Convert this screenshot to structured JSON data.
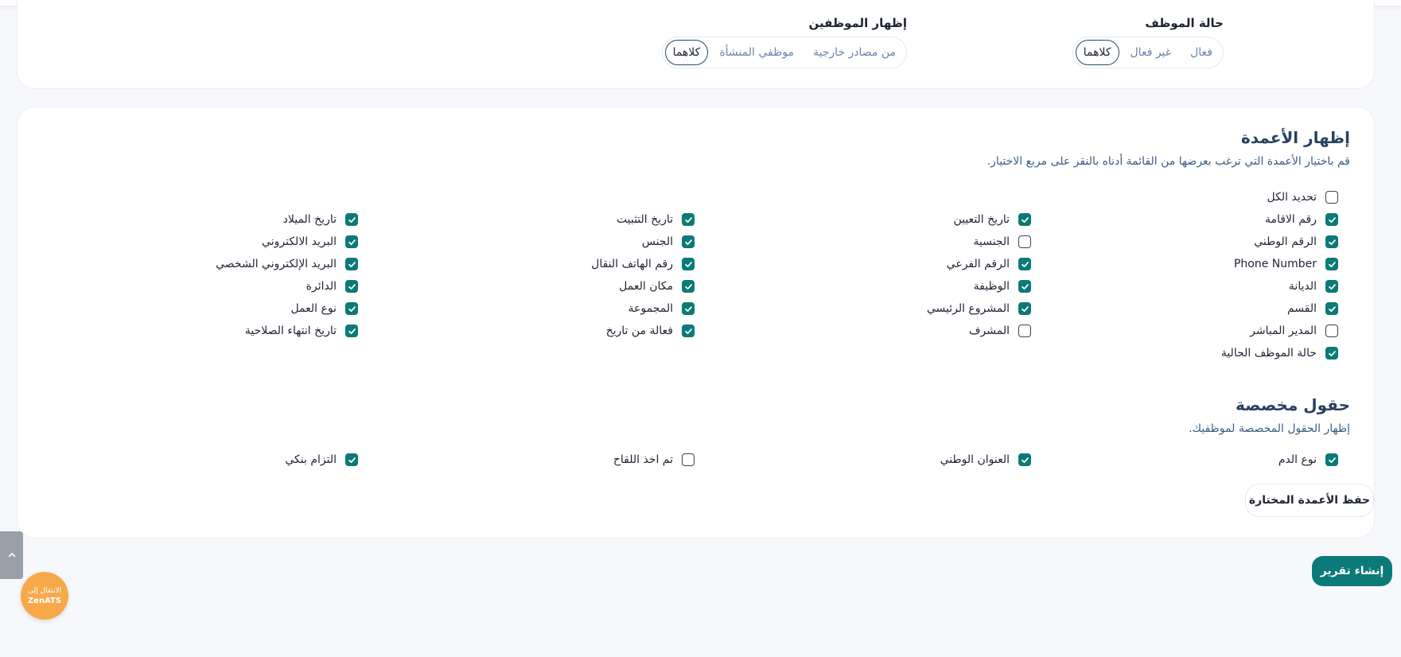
{
  "filters": {
    "status": {
      "title": "حالة الموظف",
      "options": [
        "فعال",
        "غير فعال",
        "كلاهما"
      ],
      "selected": "كلاهما"
    },
    "show_employees": {
      "title": "إظهار الموظفين",
      "options": [
        "من مصادر خارجية",
        "موظفي المنشأة",
        "كلاهما"
      ],
      "selected": "كلاهما"
    }
  },
  "columns": {
    "title": "إظهار الأعمدة",
    "subtitle": "قم باختيار الأعمدة التي ترغب بعرضها من القائمة أدناه بالنقر على مربع الاختيار.",
    "select_all": {
      "label": "تحديد الكل",
      "checked": false
    },
    "items": [
      {
        "label": "رقم الاقامة",
        "checked": true
      },
      {
        "label": "تاريخ التعيين",
        "checked": true
      },
      {
        "label": "تاريخ التثبيت",
        "checked": true
      },
      {
        "label": "تاريخ الميلاد",
        "checked": true
      },
      {
        "label": "الرقم الوطني",
        "checked": true
      },
      {
        "label": "الجنسية",
        "checked": false
      },
      {
        "label": "الجنس",
        "checked": true
      },
      {
        "label": "البريد الالكتروني",
        "checked": true
      },
      {
        "label": "Phone Number",
        "checked": true
      },
      {
        "label": "الرقم الفرعي",
        "checked": true
      },
      {
        "label": "رقم الهاتف النقال",
        "checked": true
      },
      {
        "label": "البريد الإلكتروني الشخصي",
        "checked": true
      },
      {
        "label": "الديانة",
        "checked": true
      },
      {
        "label": "الوظيفة",
        "checked": true
      },
      {
        "label": "مكان العمل",
        "checked": true
      },
      {
        "label": "الدائرة",
        "checked": true
      },
      {
        "label": "القسم",
        "checked": true
      },
      {
        "label": "المشروع الرئيسي",
        "checked": true
      },
      {
        "label": "المجموعة",
        "checked": true
      },
      {
        "label": "نوع العمل",
        "checked": true
      },
      {
        "label": "المدير المباشر",
        "checked": false
      },
      {
        "label": "المشرف",
        "checked": false
      },
      {
        "label": "فعالة من تاريخ",
        "checked": true
      },
      {
        "label": "تاريخ انتهاء الصلاحية",
        "checked": true
      },
      {
        "label": "حالة الموظف الحالية",
        "checked": true
      }
    ]
  },
  "custom_fields": {
    "title": "حقول مخصصة",
    "subtitle": "إظهار الحقول المخصصة لموظفيك.",
    "items": [
      {
        "label": "نوع الدم",
        "checked": true
      },
      {
        "label": "العنوان الوطني",
        "checked": true
      },
      {
        "label": "تم اخذ اللقاح",
        "checked": false
      },
      {
        "label": "التزام بنكي",
        "checked": true
      }
    ]
  },
  "actions": {
    "save_label": "حفظ الأعمدة المختارة",
    "report_label": "إنشاء تقرير"
  },
  "zen_badge": {
    "line1": "الانتقال إلى",
    "line2": "ZenATS"
  },
  "icons": {
    "scroll_top": "chevron-up-icon",
    "checkbox": "check-icon"
  },
  "colors": {
    "accent": "#0b7a78",
    "badge": "#f7a94a",
    "heading": "#2a4160"
  }
}
